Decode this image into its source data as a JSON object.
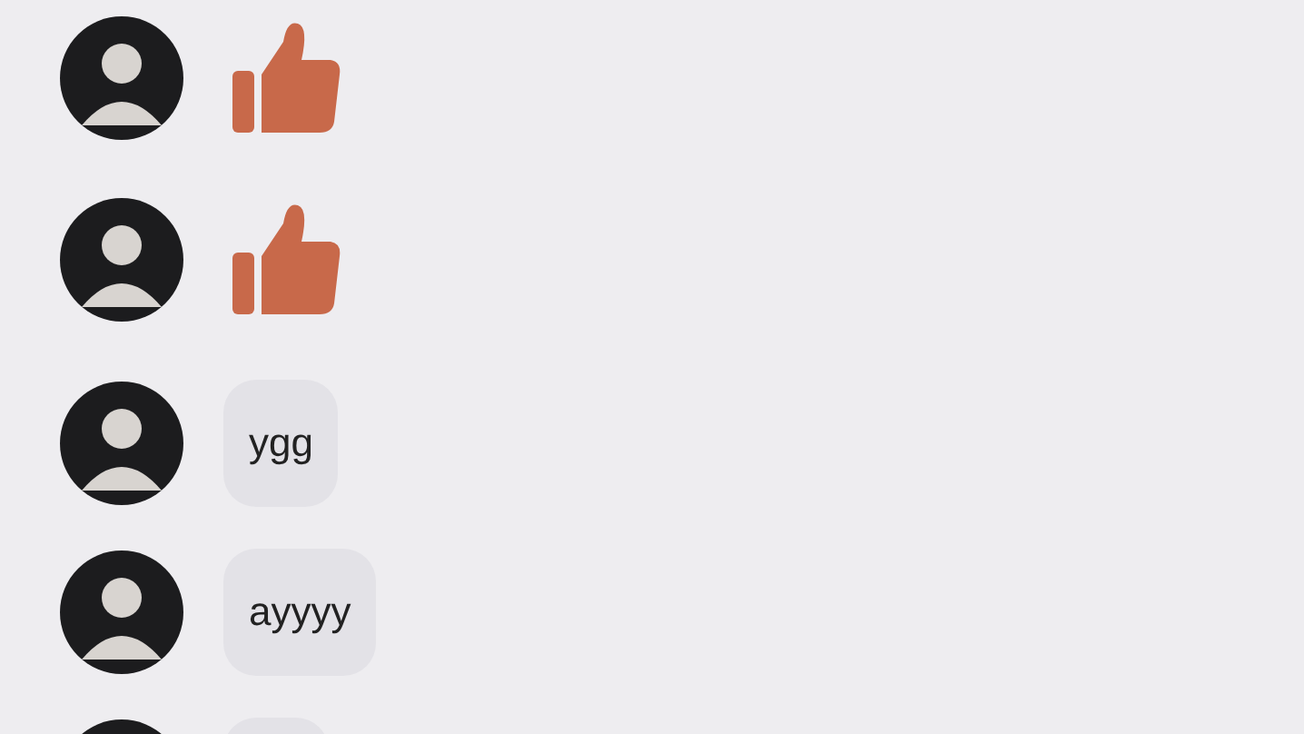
{
  "messages": [
    {
      "kind": "like"
    },
    {
      "kind": "like"
    },
    {
      "kind": "text",
      "text": "ygg"
    },
    {
      "kind": "text",
      "text": "ayyyy"
    },
    {
      "kind": "text"
    }
  ]
}
